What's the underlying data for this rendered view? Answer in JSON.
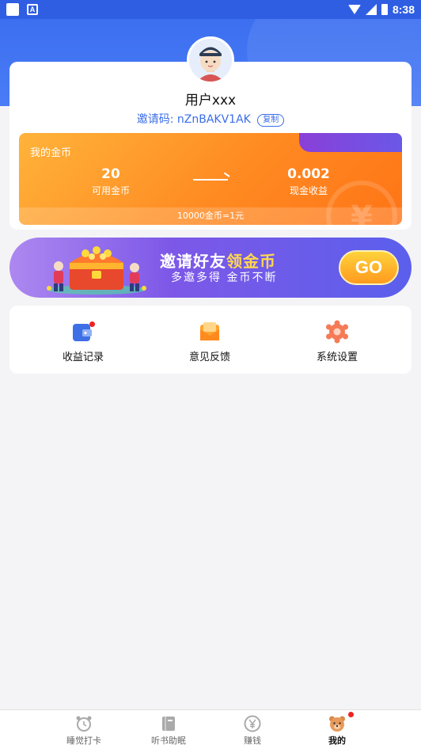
{
  "status_bar": {
    "time": "8:38",
    "notification_glyph": "A"
  },
  "profile": {
    "username": "用户xxx",
    "invite_label": "邀请码: nZnBAKV1AK",
    "copy_label": "复制"
  },
  "coins": {
    "title": "我的金币",
    "available_value": "20",
    "available_label": "可用金币",
    "cash_value": "0.002",
    "cash_label": "现金收益",
    "rate_note": "10000金币=1元",
    "watermark": "¥"
  },
  "banner": {
    "title_part1": "邀请好友",
    "title_part2": "领金币",
    "subtitle": "多邀多得 金币不断",
    "go_label": "GO"
  },
  "menu": {
    "items": [
      {
        "label": "收益记录",
        "icon": "wallet-icon",
        "has_badge": true
      },
      {
        "label": "意见反馈",
        "icon": "feedback-mail-icon",
        "has_badge": false
      },
      {
        "label": "系统设置",
        "icon": "gear-icon",
        "has_badge": false
      }
    ]
  },
  "tabs": [
    {
      "label": "睡觉打卡",
      "icon": "alarm-clock-icon",
      "active": false
    },
    {
      "label": "听书助眠",
      "icon": "book-icon",
      "active": false
    },
    {
      "label": "赚钱",
      "icon": "yen-coin-icon",
      "active": false
    },
    {
      "label": "我的",
      "icon": "bear-icon",
      "active": true,
      "has_badge": true
    }
  ],
  "colors": {
    "primary_blue": "#3c6ff0",
    "invite_blue": "#3a6ee8",
    "coin_orange": "#ff8a22",
    "banner_purple": "#7d58e8",
    "badge_red": "#ee2222"
  }
}
